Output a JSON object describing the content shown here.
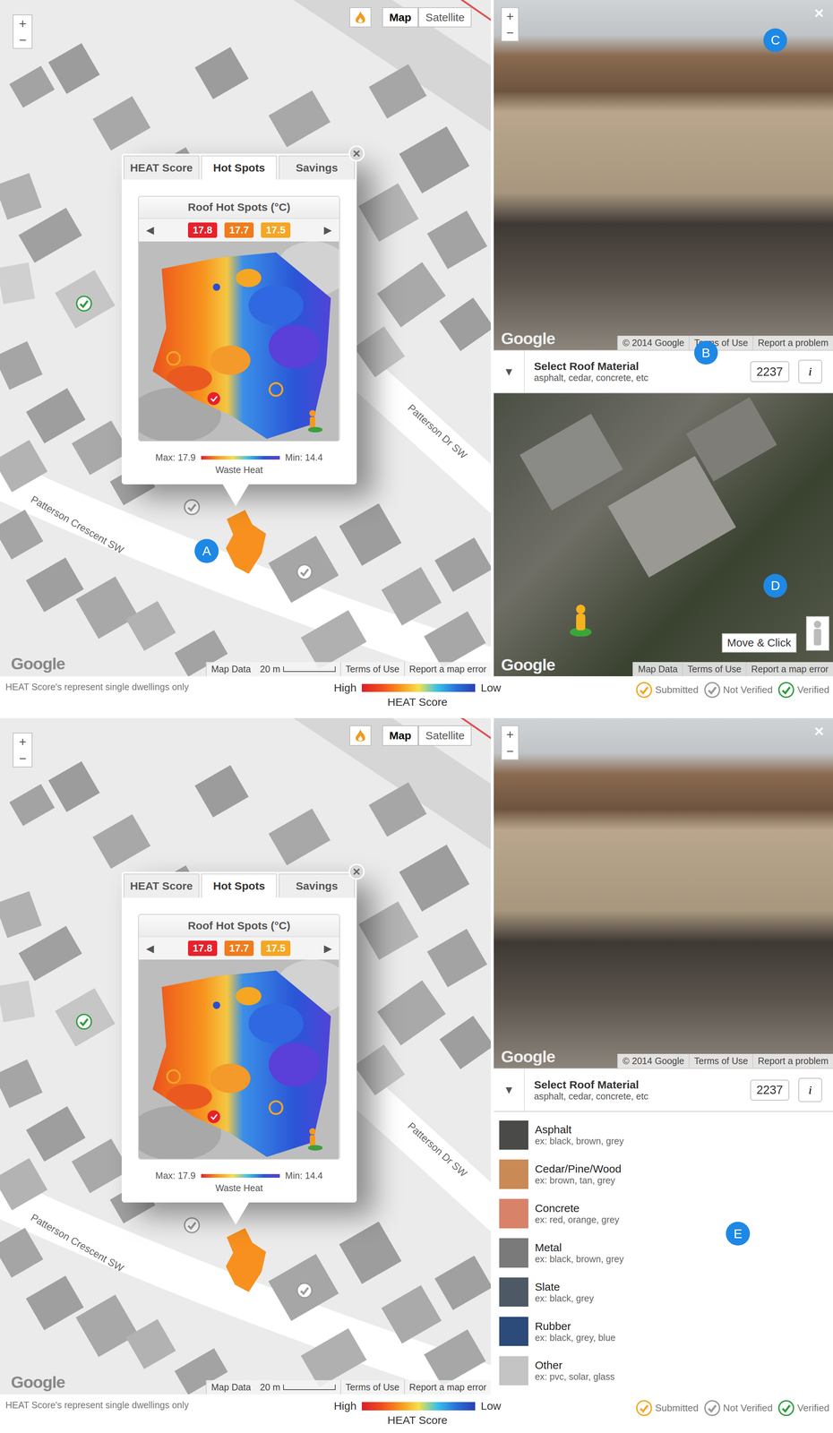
{
  "map": {
    "zoom_controls": [
      "+",
      "−"
    ],
    "type_buttons": [
      {
        "label": "Map",
        "selected": true
      },
      {
        "label": "Satellite",
        "selected": false
      }
    ],
    "street_labels": [
      "Patterson Crescent SW",
      "Patterson Dr SW"
    ],
    "selected_house": {
      "color": "#f7901e"
    },
    "house_badges": [
      {
        "status": "verified"
      },
      {
        "status": "not-verified"
      },
      {
        "status": "not-verified"
      }
    ],
    "footer": {
      "logo": "Google",
      "links": [
        "Map Data",
        "Terms of Use",
        "Report a map error"
      ],
      "scale": "20 m"
    }
  },
  "popup": {
    "tabs": [
      {
        "label": "HEAT Score",
        "selected": false
      },
      {
        "label": "Hot Spots",
        "selected": true
      },
      {
        "label": "Savings",
        "selected": false
      }
    ],
    "title": "Roof Hot Spots (°C)",
    "prev": "◀",
    "next": "▶",
    "hot_spots": [
      {
        "value": "17.8",
        "color": "#e8202a"
      },
      {
        "value": "17.7",
        "color": "#f07c1c"
      },
      {
        "value": "17.5",
        "color": "#f5a623"
      }
    ],
    "scale": {
      "max": "Max: 17.9",
      "min": "Min: 14.4",
      "caption": "Waste Heat"
    }
  },
  "legend_bar": {
    "note": "HEAT Score's represent single dwellings only",
    "high": "High",
    "low": "Low",
    "caption": "HEAT Score",
    "statuses": [
      {
        "status": "submitted",
        "label": "Submitted",
        "color": "#f5a623"
      },
      {
        "status": "not-verified",
        "label": "Not Verified",
        "color": "#9a9a9a"
      },
      {
        "status": "verified",
        "label": "Verified",
        "color": "#2e9e3e"
      }
    ]
  },
  "street_view": {
    "logo": "Google",
    "links": [
      "© 2014 Google",
      "Terms of Use",
      "Report a problem"
    ],
    "zoom_controls": [
      "+",
      "−"
    ],
    "close": "×"
  },
  "roof_material": {
    "toggle": "▼",
    "title": "Select Roof Material",
    "hint": "asphalt, cedar, concrete, etc",
    "code": "2237",
    "info": "i"
  },
  "satellite": {
    "logo": "Google",
    "links": [
      "Map Data",
      "Terms of Use",
      "Report a map error"
    ],
    "button": "Move & Click"
  },
  "roof_options": [
    {
      "name": "Asphalt",
      "example": "ex: black, brown, grey",
      "color": "#4a4a48"
    },
    {
      "name": "Cedar/Pine/Wood",
      "example": "ex: brown, tan, grey",
      "color": "#c98a55"
    },
    {
      "name": "Concrete",
      "example": "ex: red, orange, grey",
      "color": "#d9826a"
    },
    {
      "name": "Metal",
      "example": "ex: black, brown, grey",
      "color": "#7a7a7a"
    },
    {
      "name": "Slate",
      "example": "ex: black, grey",
      "color": "#4d5a66"
    },
    {
      "name": "Rubber",
      "example": "ex: black, grey, blue",
      "color": "#2c4a7a"
    },
    {
      "name": "Other",
      "example": "ex: pvc, solar, glass",
      "color": "#c4c4c4"
    }
  ],
  "panels": [
    {
      "view": "satellite",
      "markers": [
        {
          "label": "A",
          "target": "house"
        },
        {
          "label": "B",
          "target": "roof-bar"
        },
        {
          "label": "C",
          "target": "street-view"
        },
        {
          "label": "D",
          "target": "satellite"
        }
      ]
    },
    {
      "view": "dropdown",
      "markers": [
        {
          "label": "E",
          "target": "dropdown"
        }
      ]
    }
  ]
}
